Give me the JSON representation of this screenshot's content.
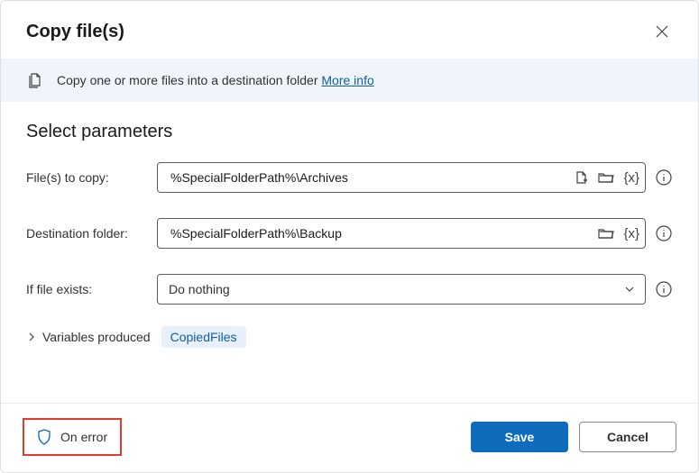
{
  "dialog": {
    "title": "Copy file(s)",
    "info_text": "Copy one or more files into a destination folder",
    "more_info": "More info"
  },
  "section": {
    "title": "Select parameters"
  },
  "fields": {
    "files_to_copy": {
      "label": "File(s) to copy:",
      "value": "%SpecialFolderPath%\\Archives"
    },
    "destination": {
      "label": "Destination folder:",
      "value": "%SpecialFolderPath%\\Backup"
    },
    "if_exists": {
      "label": "If file exists:",
      "value": "Do nothing"
    }
  },
  "variables": {
    "label": "Variables produced",
    "pill": "CopiedFiles"
  },
  "footer": {
    "on_error": "On error",
    "save": "Save",
    "cancel": "Cancel"
  },
  "icons": {
    "file_select": "file-select-icon",
    "folder": "folder-icon",
    "variable": "variable-icon",
    "info": "info-icon",
    "chevron_down": "chevron-down-icon",
    "chevron_right": "chevron-right-icon",
    "close": "close-icon",
    "copy": "copy-icon",
    "shield": "shield-icon"
  }
}
